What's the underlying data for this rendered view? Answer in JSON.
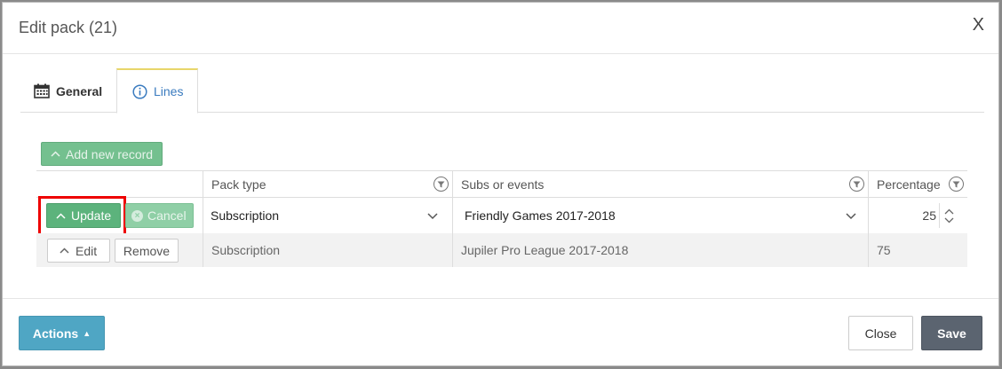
{
  "dialog": {
    "title": "Edit pack (21)",
    "close_glyph": "X"
  },
  "tabs": [
    {
      "label": "General",
      "icon": "calendar-icon",
      "active": false
    },
    {
      "label": "Lines",
      "icon": "info-circle-icon",
      "active": true
    }
  ],
  "toolbar": {
    "add_label": "Add new record"
  },
  "grid": {
    "columns": [
      "Pack type",
      "Subs or events",
      "Percentage"
    ],
    "edit_row": {
      "update_label": "Update",
      "cancel_label": "Cancel",
      "pack_type": "Subscription",
      "subs_or_events": "Friendly Games 2017-2018",
      "percentage": "25"
    },
    "rows": [
      {
        "edit_label": "Edit",
        "remove_label": "Remove",
        "pack_type": "Subscription",
        "subs_or_events": "Jupiler Pro League 2017-2018",
        "percentage": "75"
      }
    ]
  },
  "footer": {
    "actions_label": "Actions",
    "close_label": "Close",
    "save_label": "Save"
  },
  "colors": {
    "update_green": "#5cb37c",
    "actions_blue": "#4fa6c4",
    "save_gray": "#5b6470",
    "highlight_red": "#ee0000",
    "active_tab_text": "#3a7bbf"
  }
}
